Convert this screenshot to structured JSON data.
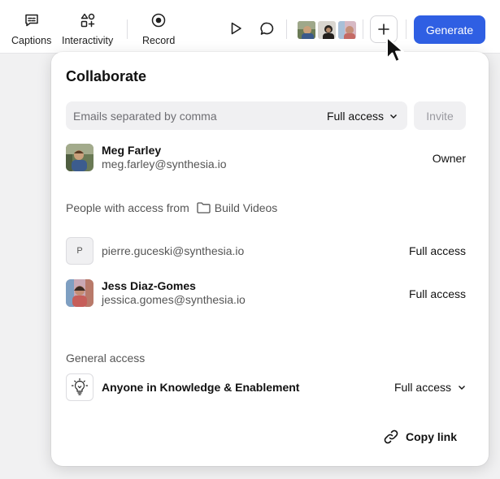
{
  "toolbar": {
    "tools": [
      {
        "label": "Captions",
        "icon": "captions-icon"
      },
      {
        "label": "Interactivity",
        "icon": "interactivity-icon"
      },
      {
        "label": "Record",
        "icon": "record-icon"
      }
    ],
    "play_icon": "play-icon",
    "comment_icon": "comment-icon",
    "add_icon": "plus-icon",
    "generate_label": "Generate",
    "accent_color": "#2f5fe3"
  },
  "collaborate": {
    "title": "Collaborate",
    "email_placeholder": "Emails separated by comma",
    "access_selected": "Full access",
    "invite_label": "Invite",
    "owner": {
      "name": "Meg Farley",
      "email": "meg.farley@synthesia.io",
      "role": "Owner"
    },
    "access_from": {
      "label": "People with access from",
      "folder": "Build Videos"
    },
    "members": [
      {
        "initial": "P",
        "name": "",
        "email": "pierre.guceski@synthesia.io",
        "role": "Full access"
      },
      {
        "initial": "",
        "name": "Jess Diaz-Gomes",
        "email": "jessica.gomes@synthesia.io",
        "role": "Full access"
      }
    ],
    "general": {
      "label": "General access",
      "name": "Anyone in Knowledge & Enablement",
      "access": "Full access"
    },
    "copy_link_label": "Copy link"
  }
}
